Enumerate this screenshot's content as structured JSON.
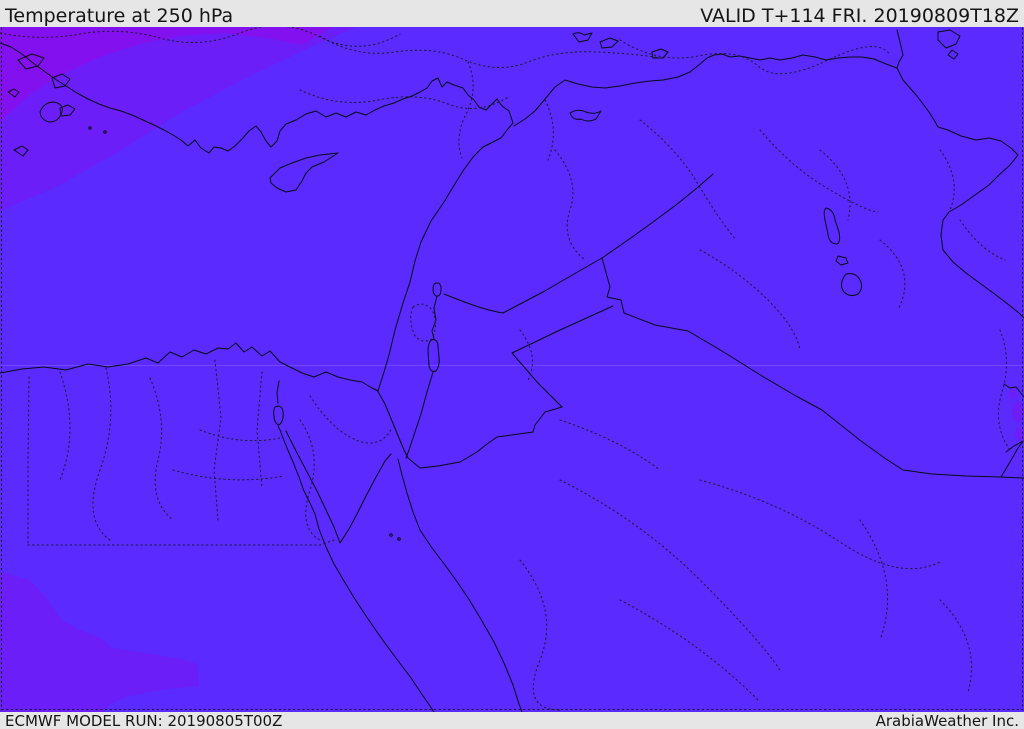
{
  "header": {
    "title": "Temperature at 250 hPa",
    "valid_label": "VALID T+114 FRI. 20190809T18Z"
  },
  "footer": {
    "model_run_label": "ECMWF MODEL RUN: 20190805T00Z",
    "brand_label": "ArabiaWeather Inc."
  },
  "map": {
    "type": "weather-temperature-map",
    "colors": {
      "band-main": "#5a2aff",
      "band-medium": "#6c1ef9",
      "band-bright": "#8310ef",
      "bar-bg": "#e6e6e6",
      "bar-text": "#151515",
      "line-solid": "#0a0a14",
      "line-dotted": "#181822",
      "graticule-faint": "rgba(255,255,255,0.15)"
    }
  }
}
